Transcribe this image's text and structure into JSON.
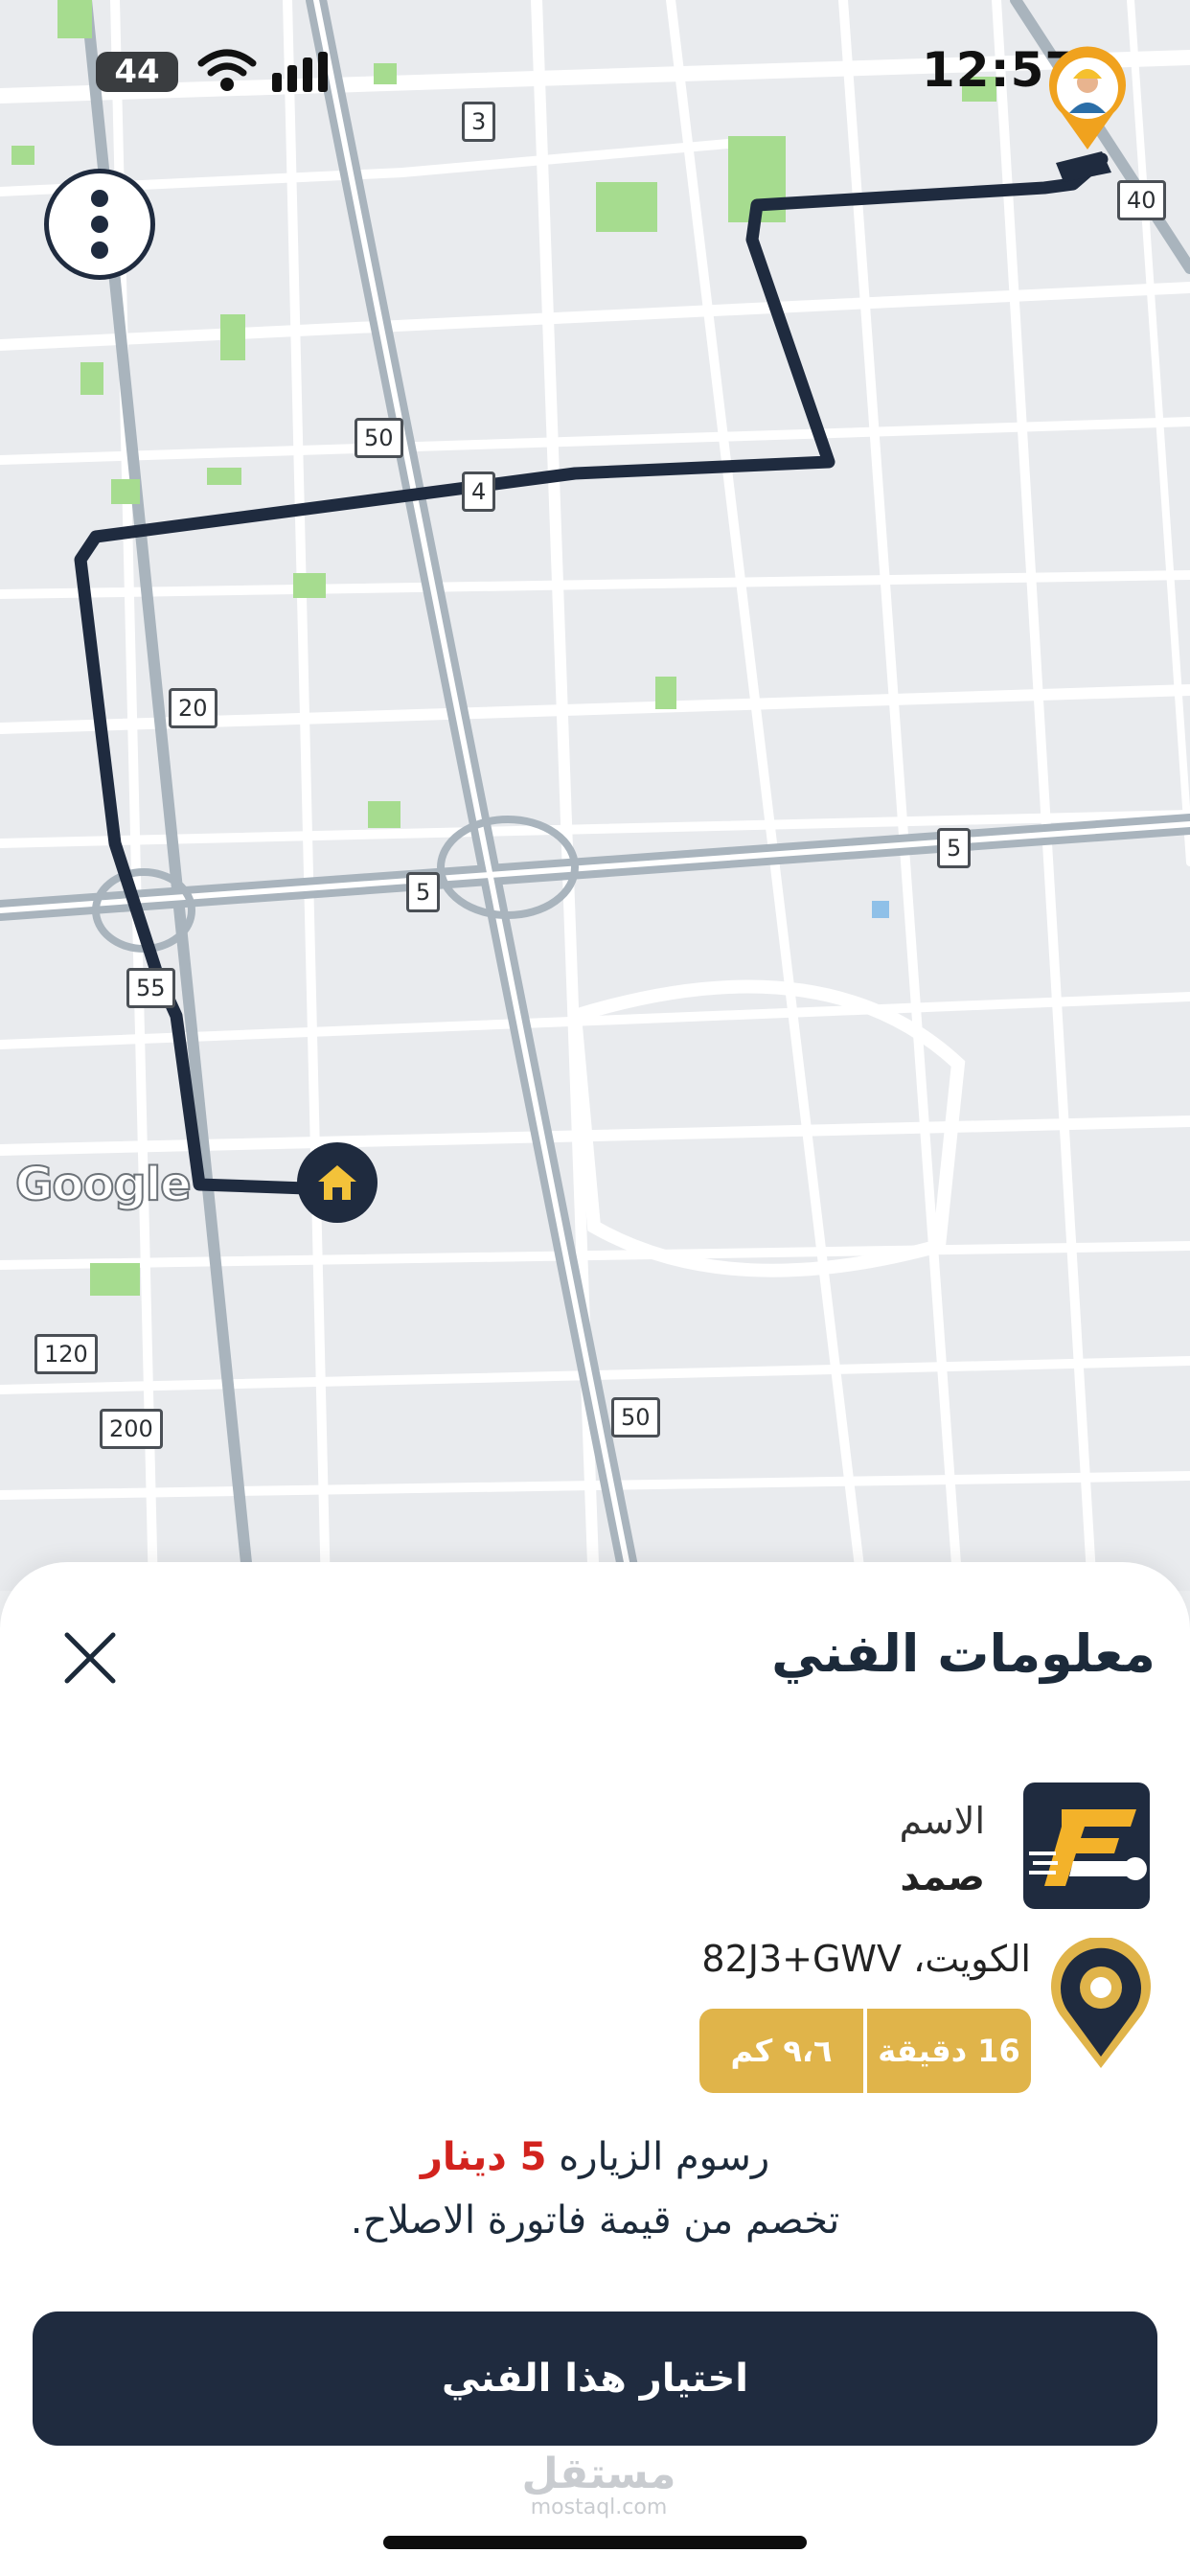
{
  "status_bar": {
    "time": "12:57",
    "battery": "44"
  },
  "map": {
    "attribution": "Google",
    "road_labels": [
      "3",
      "40",
      "50",
      "4",
      "20",
      "5",
      "5",
      "55",
      "120",
      "200",
      "50"
    ],
    "route_color": "#1f2b3f",
    "icons": [
      "menu-icon",
      "home-marker-icon",
      "technician-pin-icon"
    ]
  },
  "sheet": {
    "title": "معلومات الفني",
    "technician": {
      "name_label": "الاسم",
      "name": "صمد"
    },
    "location": {
      "address": "الكويت، 82J3+GWV",
      "distance": "٩،٦ كم",
      "duration": "16 دقيقة"
    },
    "fee": {
      "prefix": "رسوم الزياره",
      "amount": "5 دينار",
      "note": "تخصم من قيمة فاتورة الاصلاح."
    },
    "select_button": "اختيار هذا الفني",
    "watermark_ar": "مستقل",
    "watermark_en": "mostaql.com"
  },
  "colors": {
    "primary": "#1f2b3f",
    "accent": "#e0b44a",
    "fee_red": "#d2231e"
  }
}
